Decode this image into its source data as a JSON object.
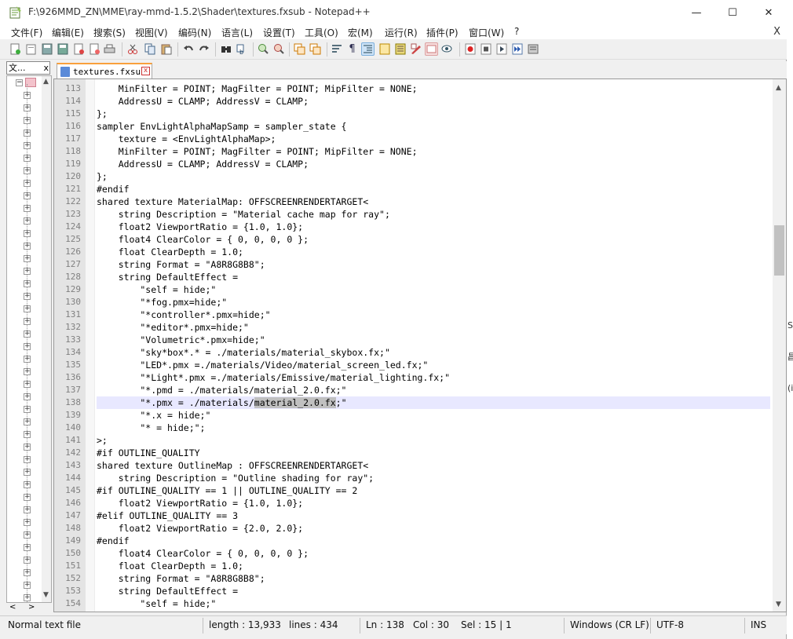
{
  "window": {
    "title": "F:\\926MMD_ZN\\MME\\ray-mmd-1.5.2\\Shader\\textures.fxsub - Notepad++",
    "minimize": "—",
    "maximize": "☐",
    "close": "✕"
  },
  "menu": {
    "items": [
      "文件(F)",
      "编辑(E)",
      "搜索(S)",
      "视图(V)",
      "编码(N)",
      "语言(L)",
      "设置(T)",
      "工具(O)",
      "宏(M)",
      "运行(R)",
      "插件(P)",
      "窗口(W)",
      "?"
    ],
    "close": "X"
  },
  "toolbar": {
    "icons": [
      "new-file-icon",
      "open-file-icon",
      "save-icon",
      "save-all-icon",
      "close-icon",
      "close-all-icon",
      "print-icon",
      "cut-icon",
      "copy-icon",
      "paste-icon",
      "undo-icon",
      "redo-icon",
      "find-icon",
      "replace-icon",
      "zoom-in-icon",
      "zoom-out-icon",
      "sync-vertical-icon",
      "sync-horizontal-icon",
      "word-wrap-icon",
      "show-all-chars-icon",
      "indent-guide-icon",
      "doc-map-icon",
      "function-list-icon",
      "folder-workspace-icon",
      "monitor-icon",
      "eye-icon",
      "record-macro-icon",
      "stop-record-icon",
      "play-macro-icon",
      "run-macro-multiple-icon",
      "save-macro-icon"
    ]
  },
  "left_panel": {
    "tab_label": "文...",
    "tab_close": "x",
    "expand_glyph": "+",
    "collapse_glyph": "−",
    "nav_left": "<",
    "nav_right": ">"
  },
  "editor": {
    "tab_label": "textures.fxsub",
    "tab_close": "x",
    "current_line": 138,
    "lines": [
      {
        "n": "113",
        "t": "    MinFilter = POINT; MagFilter = POINT; MipFilter = NONE;"
      },
      {
        "n": "114",
        "t": "    AddressU = CLAMP; AddressV = CLAMP;"
      },
      {
        "n": "115",
        "t": "};"
      },
      {
        "n": "116",
        "t": "sampler EnvLightAlphaMapSamp = sampler_state {"
      },
      {
        "n": "117",
        "t": "    texture = <EnvLightAlphaMap>;"
      },
      {
        "n": "118",
        "t": "    MinFilter = POINT; MagFilter = POINT; MipFilter = NONE;"
      },
      {
        "n": "119",
        "t": "    AddressU = CLAMP; AddressV = CLAMP;"
      },
      {
        "n": "120",
        "t": "};"
      },
      {
        "n": "121",
        "t": "#endif"
      },
      {
        "n": "122",
        "t": "shared texture MaterialMap: OFFSCREENRENDERTARGET<"
      },
      {
        "n": "123",
        "t": "    string Description = \"Material cache map for ray\";"
      },
      {
        "n": "124",
        "t": "    float2 ViewportRatio = {1.0, 1.0};"
      },
      {
        "n": "125",
        "t": "    float4 ClearColor = { 0, 0, 0, 0 };"
      },
      {
        "n": "126",
        "t": "    float ClearDepth = 1.0;"
      },
      {
        "n": "127",
        "t": "    string Format = \"A8R8G8B8\";"
      },
      {
        "n": "128",
        "t": "    string DefaultEffect ="
      },
      {
        "n": "129",
        "t": "        \"self = hide;\""
      },
      {
        "n": "130",
        "t": "        \"*fog.pmx=hide;\""
      },
      {
        "n": "131",
        "t": "        \"*controller*.pmx=hide;\""
      },
      {
        "n": "132",
        "t": "        \"*editor*.pmx=hide;\""
      },
      {
        "n": "133",
        "t": "        \"Volumetric*.pmx=hide;\""
      },
      {
        "n": "134",
        "t": "        \"sky*box*.* = ./materials/material_skybox.fx;\""
      },
      {
        "n": "135",
        "t": "        \"LED*.pmx =./materials/Video/material_screen_led.fx;\""
      },
      {
        "n": "136",
        "t": "        \"*Light*.pmx =./materials/Emissive/material_lighting.fx;\""
      },
      {
        "n": "137",
        "t": "        \"*.pmd = ./materials/material_2.0.fx;\""
      },
      {
        "n": "138",
        "t_pre": "        \"*.pmx = ./materials/",
        "t_sel": "material_2.0.fx",
        "t_post": ";\""
      },
      {
        "n": "139",
        "t": "        \"*.x = hide;\""
      },
      {
        "n": "140",
        "t": "        \"* = hide;\";"
      },
      {
        "n": "141",
        "t": ">;"
      },
      {
        "n": "142",
        "t": "#if OUTLINE_QUALITY"
      },
      {
        "n": "143",
        "t": "shared texture OutlineMap : OFFSCREENRENDERTARGET<"
      },
      {
        "n": "144",
        "t": "    string Description = \"Outline shading for ray\";"
      },
      {
        "n": "145",
        "t": "#if OUTLINE_QUALITY == 1 || OUTLINE_QUALITY == 2"
      },
      {
        "n": "146",
        "t": "    float2 ViewportRatio = {1.0, 1.0};"
      },
      {
        "n": "147",
        "t": "#elif OUTLINE_QUALITY == 3"
      },
      {
        "n": "148",
        "t": "    float2 ViewportRatio = {2.0, 2.0};"
      },
      {
        "n": "149",
        "t": "#endif"
      },
      {
        "n": "150",
        "t": "    float4 ClearColor = { 0, 0, 0, 0 };"
      },
      {
        "n": "151",
        "t": "    float ClearDepth = 1.0;"
      },
      {
        "n": "152",
        "t": "    string Format = \"A8R8G8B8\";"
      },
      {
        "n": "153",
        "t": "    string DefaultEffect ="
      },
      {
        "n": "154",
        "t": "        \"self = hide;\""
      }
    ]
  },
  "status": {
    "file_type": "Normal text file",
    "length": "length : 13,933",
    "lines": "lines : 434",
    "ln": "Ln : 138",
    "col": "Col : 30",
    "sel": "Sel : 15 | 1",
    "eol": "Windows (CR LF)",
    "encoding": "UTF-8",
    "mode": "INS"
  },
  "edge_fragments": [
    "S",
    "昌",
    "(i"
  ],
  "colors": {
    "accent_tab": "#f9a03c",
    "current_line": "#e8e8ff",
    "selection": "#c0c0c0",
    "gutter": "#e4e4e4"
  }
}
